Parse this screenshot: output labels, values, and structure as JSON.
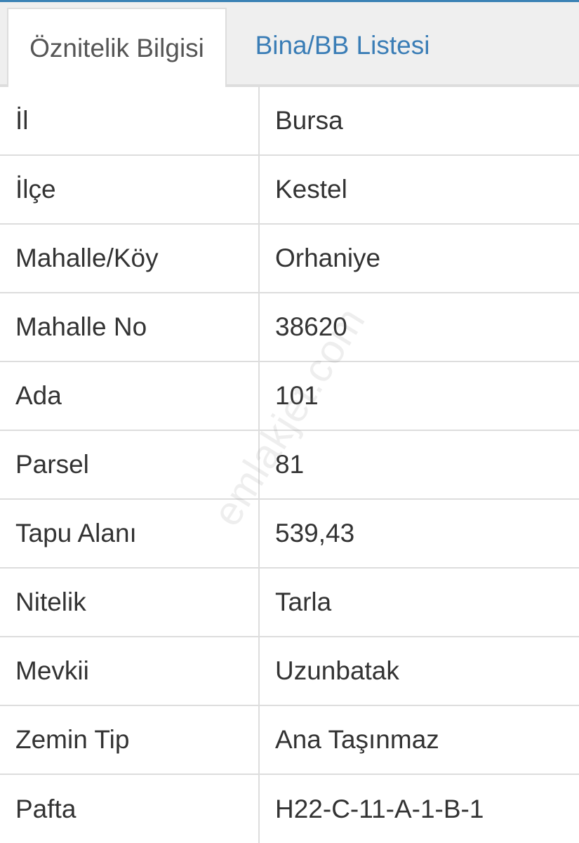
{
  "tabs": {
    "active_label": "Öznitelik Bilgisi",
    "inactive_label": "Bina/BB Listesi"
  },
  "rows": [
    {
      "key": "İl",
      "value": "Bursa"
    },
    {
      "key": "İlçe",
      "value": "Kestel"
    },
    {
      "key": "Mahalle/Köy",
      "value": "Orhaniye"
    },
    {
      "key": "Mahalle No",
      "value": "38620"
    },
    {
      "key": "Ada",
      "value": "101"
    },
    {
      "key": "Parsel",
      "value": "81"
    },
    {
      "key": "Tapu Alanı",
      "value": "539,43"
    },
    {
      "key": "Nitelik",
      "value": "Tarla"
    },
    {
      "key": "Mevkii",
      "value": "Uzunbatak"
    },
    {
      "key": "Zemin Tip",
      "value": "Ana Taşınmaz"
    },
    {
      "key": "Pafta",
      "value": "H22-C-11-A-1-B-1"
    }
  ],
  "watermark": "emlakjet.com",
  "colors": {
    "accent": "#3a7db6",
    "border": "#dddddd",
    "text": "#333333",
    "tabbar_bg": "#efefef"
  }
}
